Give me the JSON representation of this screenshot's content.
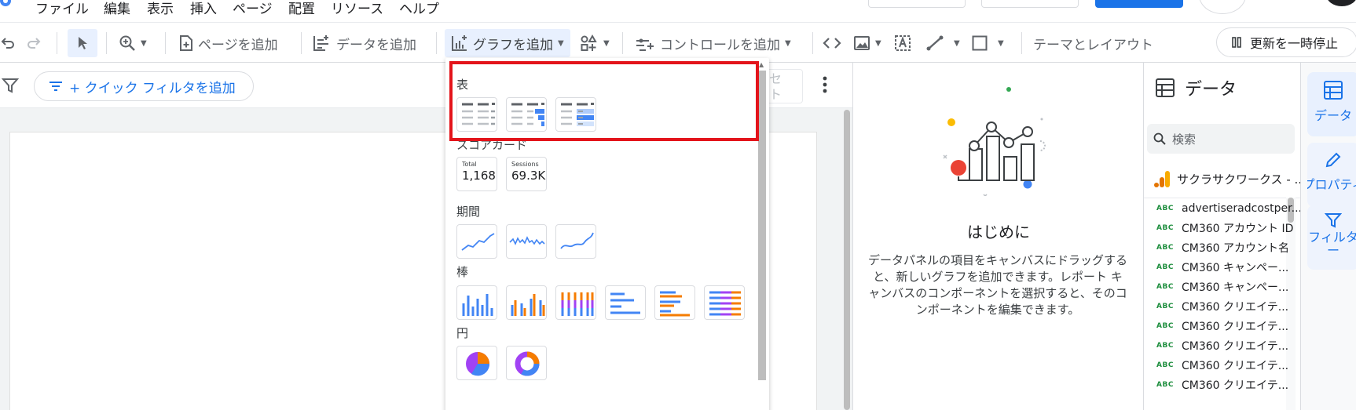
{
  "menu": {
    "items": [
      "ファイル",
      "編集",
      "表示",
      "挿入",
      "ページ",
      "配置",
      "リソース",
      "ヘルプ"
    ]
  },
  "toolbar": {
    "add_page": "ページを追加",
    "add_data": "データを追加",
    "add_chart": "グラフを追加",
    "add_control": "コントロールを追加",
    "theme_layout": "テーマとレイアウト",
    "pause_updates": "更新を一時停止"
  },
  "filterbar": {
    "quick_filter": "+ クイック フィルタを追加",
    "ghost_text": "セ\nト"
  },
  "chart_picker": {
    "table_label": "表",
    "scorecard_label": "スコアカード",
    "scorecards": [
      {
        "label": "Total",
        "value": "1,168"
      },
      {
        "label": "Sessions",
        "value": "69.3K"
      }
    ],
    "timeseries_label": "期間",
    "bar_label": "棒",
    "pie_label": "円"
  },
  "getting_started": {
    "title": "はじめに",
    "description": "データパネルの項目をキャンバスにドラッグすると、新しいグラフを追加できます。レポート キャンバスのコンポーネントを選択すると、そのコンポーネントを編集できます。"
  },
  "data_panel": {
    "title": "データ",
    "search_placeholder": "検索",
    "source_name": "サクラサクワークス - ...",
    "field_type_badge": "ABC",
    "fields": [
      "advertiseradcostper...",
      "CM360 アカウント ID",
      "CM360 アカウント名",
      "CM360 キャンペー...",
      "CM360 キャンペー...",
      "CM360 クリエイテ...",
      "CM360 クリエイテ...",
      "CM360 クリエイテ...",
      "CM360 クリエイテ...",
      "CM360 クリエイテ..."
    ]
  },
  "right_rail": {
    "data_tab": "データ",
    "properties_tab": "プロパティ",
    "filter_tab": "フィルタ\nー"
  },
  "colors": {
    "accent": "#1a73e8",
    "highlight": "#e3141b",
    "bar_orange": "#f57c00",
    "bar_purple": "#a142f4"
  }
}
